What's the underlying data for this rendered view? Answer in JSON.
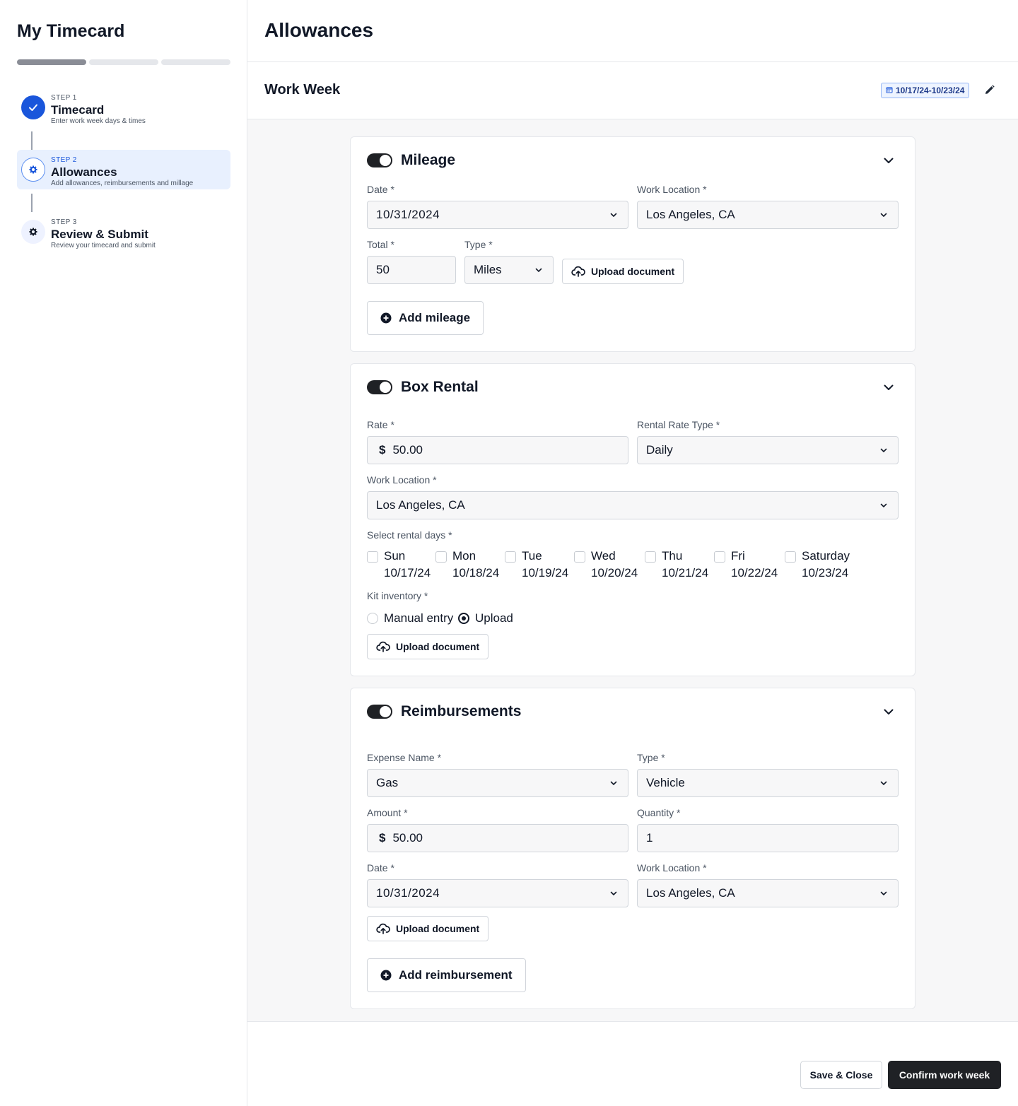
{
  "sidebar": {
    "title": "My Timecard",
    "steps": [
      {
        "step": "STEP 1",
        "name": "Timecard",
        "desc": "Enter work week days & times",
        "status": "complete"
      },
      {
        "step": "STEP 2",
        "name": "Allowances",
        "desc": "Add allowances, reimbursements and millage",
        "status": "current"
      },
      {
        "step": "STEP 3",
        "name": "Review & Submit",
        "desc": "Review your timecard and submit",
        "status": "pending"
      }
    ]
  },
  "header": {
    "title": "Allowances"
  },
  "work_week": {
    "title": "Work Week",
    "range": "10/17/24-10/23/24"
  },
  "mileage": {
    "title": "Mileage",
    "enabled": true,
    "date_label": "Date *",
    "date_value": "10/31/2024",
    "location_label": "Work Location *",
    "location_value": "Los Angeles, CA",
    "total_label": "Total *",
    "total_value": "50",
    "type_label": "Type *",
    "type_value": "Miles",
    "upload_label": "Upload document",
    "add_label": "Add mileage"
  },
  "box_rental": {
    "title": "Box Rental",
    "enabled": true,
    "rate_label": "Rate *",
    "rate_currency": "$",
    "rate_value": "50.00",
    "rate_type_label": "Rental Rate Type *",
    "rate_type_value": "Daily",
    "location_label": "Work Location *",
    "location_value": "Los Angeles, CA",
    "days_label": "Select rental days *",
    "days": [
      {
        "name": "Sun",
        "date": "10/17/24"
      },
      {
        "name": "Mon",
        "date": "10/18/24"
      },
      {
        "name": "Tue",
        "date": "10/19/24"
      },
      {
        "name": "Wed",
        "date": "10/20/24"
      },
      {
        "name": "Thu",
        "date": "10/21/24"
      },
      {
        "name": "Fri",
        "date": "10/22/24"
      },
      {
        "name": "Saturday",
        "date": "10/23/24"
      }
    ],
    "kit_label": "Kit inventory *",
    "kit_options": [
      "Manual entry",
      "Upload"
    ],
    "kit_selected": "Upload",
    "upload_label": "Upload document"
  },
  "reimbursements": {
    "title": "Reimbursements",
    "enabled": true,
    "expense_label": "Expense Name *",
    "expense_value": "Gas",
    "type_label": "Type *",
    "type_value": "Vehicle",
    "amount_label": "Amount *",
    "amount_currency": "$",
    "amount_value": "50.00",
    "quantity_label": "Quantity *",
    "quantity_value": "1",
    "date_label": "Date *",
    "date_value": "10/31/2024",
    "location_label": "Work Location *",
    "location_value": "Los Angeles, CA",
    "upload_label": "Upload document",
    "add_label": "Add reimbursement"
  },
  "footer": {
    "save_label": "Save & Close",
    "confirm_label": "Confirm work week"
  },
  "colors": {
    "accent": "#1a56db",
    "primary_button": "#1f2125",
    "badge_bg": "#eef4ff"
  }
}
